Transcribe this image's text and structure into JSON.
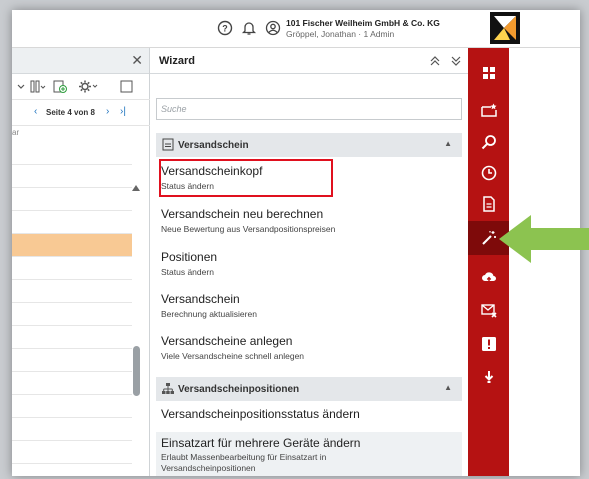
{
  "header": {
    "company": "101 Fischer Weilheim GmbH & Co. KG",
    "user": "Gröppel, Jonathan · 1 Admin",
    "icons": [
      "help-icon",
      "bell-icon",
      "user-icon"
    ]
  },
  "left_panel": {
    "pager": {
      "label": "Seite 4 von 8"
    },
    "column_fragment": "ar"
  },
  "wizard": {
    "title": "Wizard",
    "search_placeholder": "Suche",
    "section1": {
      "label": "Versandschein",
      "items": [
        {
          "title": "Versandscheinkopf",
          "subtitle": "Status ändern"
        },
        {
          "title": "Versandschein neu berechnen",
          "subtitle": "Neue Bewertung aus Versandpositionspreisen"
        },
        {
          "title": "Positionen",
          "subtitle": "Status ändern"
        },
        {
          "title": "Versandschein",
          "subtitle": "Berechnung aktualisieren"
        },
        {
          "title": "Versandscheine anlegen",
          "subtitle": "Viele Versandscheine schnell anlegen"
        }
      ]
    },
    "section2": {
      "label": "Versandscheinpositionen",
      "items": [
        {
          "title": "Versandscheinpositionsstatus ändern"
        },
        {
          "title": "Einsatzart für mehrere Geräte ändern",
          "subtitle1": "Erlaubt Massenbearbeitung für Einsatzart in",
          "subtitle2": "Versandscheinpositionen"
        }
      ]
    }
  },
  "rightbar": {
    "icons": [
      "grid-icon",
      "star-screen-icon",
      "search-icon",
      "clock-icon",
      "document-icon",
      "magic-wand-icon",
      "cloud-upload-icon",
      "mail-error-icon",
      "alert-icon",
      "download-icon"
    ],
    "active_index": 5
  },
  "colors": {
    "sidebar_red": "#b51212",
    "active_red": "#7e0a0a",
    "highlight_box": "#e0101e",
    "arrow_green": "#8cc350",
    "row_highlight": "#f8c994"
  }
}
